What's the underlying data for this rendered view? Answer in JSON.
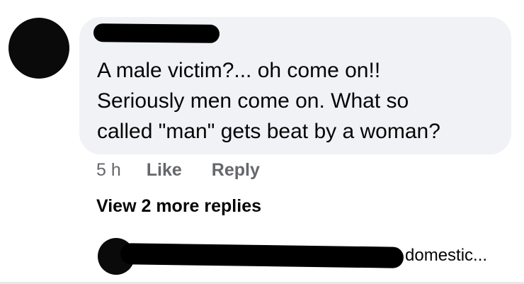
{
  "comment": {
    "author": "",
    "lines": [
      "A male victim?... oh come on!!",
      "Seriously men come on. What so",
      "called \"man\" gets beat by a woman?"
    ],
    "timestamp": "5 h",
    "like_label": "Like",
    "reply_label": "Reply"
  },
  "replies": {
    "view_more_label": "View 2 more replies",
    "preview_text": "domestic..."
  },
  "colors": {
    "bubble": "#f0f2f5",
    "text": "#050505",
    "meta": "#65676b"
  },
  "icons": {
    "commenter_avatar": "avatar-icon",
    "reply_avatar": "avatar-icon"
  }
}
